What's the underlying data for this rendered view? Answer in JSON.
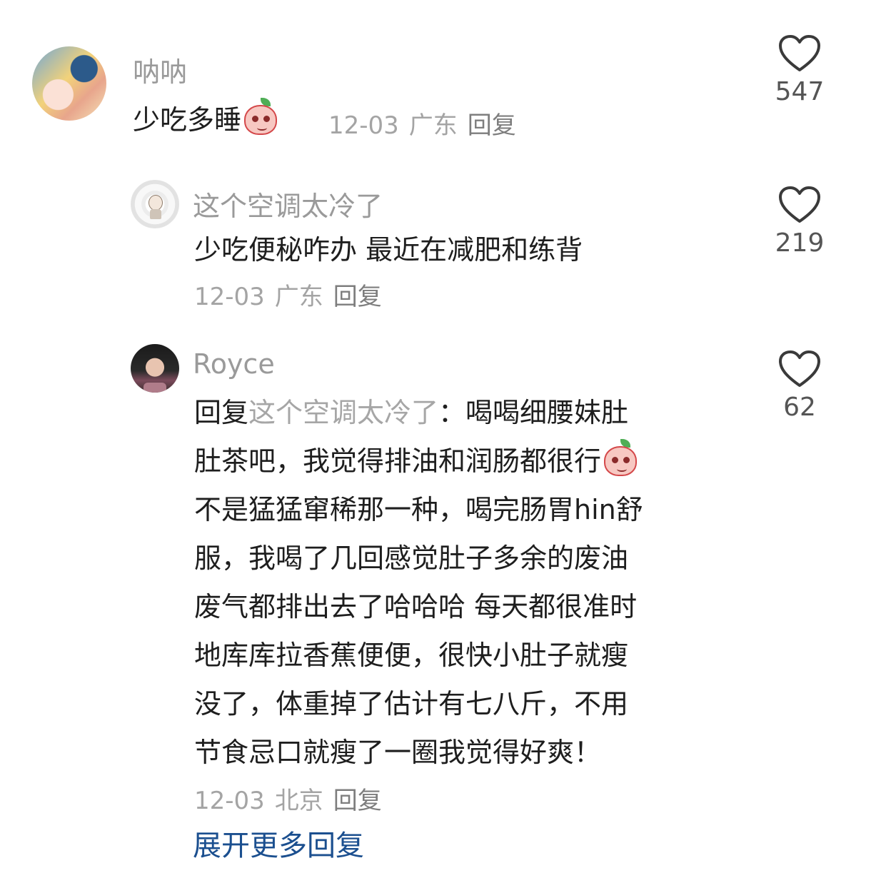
{
  "comments": [
    {
      "user": "呐呐",
      "text_lines": [
        "少吃多睡"
      ],
      "date": "12-03",
      "location": "广东",
      "reply_label": "回复",
      "likes": "547"
    },
    {
      "user": "这个空调太冷了",
      "text_lines": [
        "少吃便秘咋办 最近在减肥和练背"
      ],
      "date": "12-03",
      "location": "广东",
      "reply_label": "回复",
      "likes": "219"
    },
    {
      "user": "Royce",
      "reply_prefix": "回复",
      "mention": "这个空调太冷了",
      "line1_rest": "：喝喝细腰妹肚",
      "text_lines": [
        "肚茶吧，我觉得排油和润肠都很行",
        "不是猛猛窜稀那一种，喝完肠胃hin舒",
        "服，我喝了几回感觉肚子多余的废油",
        "废气都排出去了哈哈哈 每天都很准时",
        "地库库拉香蕉便便，很快小肚子就瘦",
        "没了，体重掉了估计有七八斤，不用",
        "节食忌口就瘦了一圈我觉得好爽！"
      ],
      "date": "12-03",
      "location": "北京",
      "reply_label": "回复",
      "likes": "62"
    }
  ],
  "expand_more_label": "展开更多回复",
  "icons": {
    "like": "heart-outline-icon",
    "emoji": "peach-emoji-icon"
  },
  "colors": {
    "link": "#1b4f8f",
    "username": "#9a9a9a",
    "text": "#1e1e1e"
  }
}
